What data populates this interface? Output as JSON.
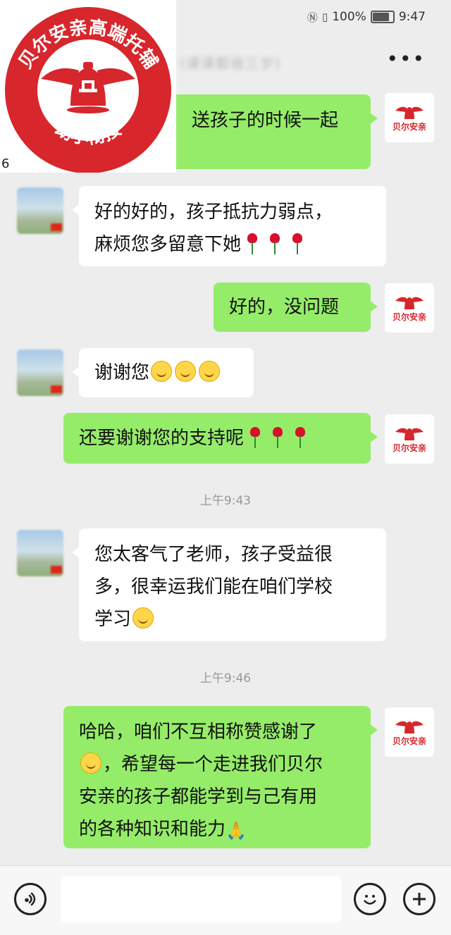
{
  "status_bar": {
    "battery_percent": "100%",
    "time": "9:47"
  },
  "header": {
    "title_blurred": "(课课都爸三岁)",
    "more_icon": "more-horizontal-icon"
  },
  "logo": {
    "ring_text": "贝尔安亲高端托辅",
    "bottom_text": "幼小衔接",
    "side_mark": "6"
  },
  "brand_avatar_label": "贝尔安亲",
  "messages": [
    {
      "side": "right",
      "text": "送孩子的时候一起"
    },
    {
      "side": "left",
      "text_line1": "好的好的，孩子抵抗力弱点，",
      "text_line2": "麻烦您多留意下她"
    },
    {
      "side": "right",
      "text": "好的，没问题"
    },
    {
      "side": "left",
      "text": "谢谢您"
    },
    {
      "side": "right",
      "text": "还要谢谢您的支持呢"
    },
    {
      "side": "left",
      "text_line1": "您太客气了老师，孩子受益很",
      "text_line2": "多，很幸运我们能在咱们学校",
      "text_line3": "学习"
    },
    {
      "side": "right",
      "text_line1": "哈哈，咱们不互相称赞感谢了",
      "text_line2": "，希望每一个走进我们贝尔",
      "text_line3": "安亲的孩子都能学到与己有用",
      "text_line4": "的各种知识和能力"
    }
  ],
  "timestamps": [
    "上午9:43",
    "上午9:46"
  ],
  "input_bar": {
    "voice_icon": "voice-icon",
    "emoji_icon": "emoji-icon",
    "plus_icon": "plus-icon"
  }
}
